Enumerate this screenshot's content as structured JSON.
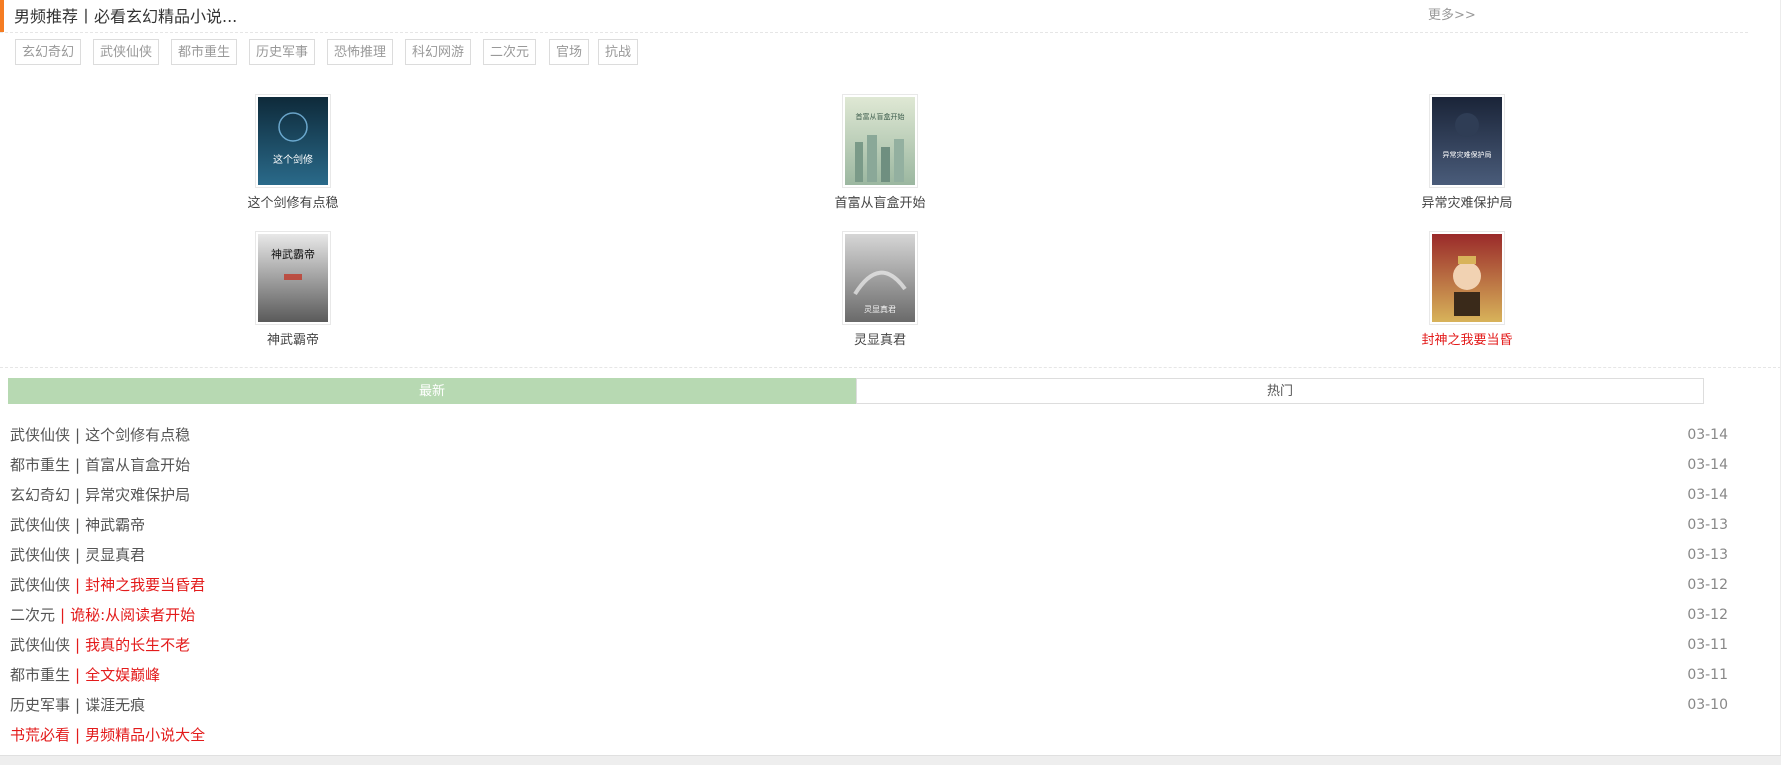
{
  "header": {
    "title": "男频推荐丨必看玄幻精品小说...",
    "more_label": "更多>>",
    "accent_color": "#f57c22"
  },
  "tags": [
    "玄幻奇幻",
    "武侠仙侠",
    "都市重生",
    "历史军事",
    "恐怖推理",
    "科幻网游",
    "二次元",
    "官场",
    "抗战"
  ],
  "books": [
    {
      "title": "这个剑修有点稳",
      "highlight": false,
      "cover_colors": [
        "#0e2a3a",
        "#2a6a8a"
      ],
      "cover_text": "这个剑修"
    },
    {
      "title": "首富从盲盒开始",
      "highlight": false,
      "cover_colors": [
        "#dfe8d4",
        "#9bb7a0"
      ],
      "cover_text": "首富从盲盒开始"
    },
    {
      "title": "异常灾难保护局",
      "highlight": false,
      "cover_colors": [
        "#1a2438",
        "#4a5c7a"
      ],
      "cover_text": "异常灾难保护局"
    },
    {
      "title": "神武霸帝",
      "highlight": false,
      "cover_colors": [
        "#e8e8e8",
        "#5a5a5a"
      ],
      "cover_text": "神武霸帝"
    },
    {
      "title": "灵显真君",
      "highlight": false,
      "cover_colors": [
        "#d6d6d6",
        "#6a6a6a"
      ],
      "cover_text": "灵显真君"
    },
    {
      "title": "封神之我要当昏",
      "highlight": true,
      "cover_colors": [
        "#9a2a2a",
        "#d8b35a"
      ],
      "cover_text": ""
    }
  ],
  "tabs": {
    "latest": "最新",
    "hot": "热门"
  },
  "list": [
    {
      "category": "武侠仙侠",
      "name": "这个剑修有点稳",
      "date": "03-14",
      "highlight": false
    },
    {
      "category": "都市重生",
      "name": "首富从盲盒开始",
      "date": "03-14",
      "highlight": false
    },
    {
      "category": "玄幻奇幻",
      "name": "异常灾难保护局",
      "date": "03-14",
      "highlight": false
    },
    {
      "category": "武侠仙侠",
      "name": "神武霸帝",
      "date": "03-13",
      "highlight": false
    },
    {
      "category": "武侠仙侠",
      "name": "灵显真君",
      "date": "03-13",
      "highlight": false
    },
    {
      "category": "武侠仙侠",
      "name": "封神之我要当昏君",
      "date": "03-12",
      "highlight": true
    },
    {
      "category": "二次元",
      "name": "诡秘:从阅读者开始",
      "date": "03-12",
      "highlight": true
    },
    {
      "category": "武侠仙侠",
      "name": "我真的长生不老",
      "date": "03-11",
      "highlight": true
    },
    {
      "category": "都市重生",
      "name": "全文娱巅峰",
      "date": "03-11",
      "highlight": true
    },
    {
      "category": "历史军事",
      "name": "谍涯无痕",
      "date": "03-10",
      "highlight": false
    },
    {
      "category": "书荒必看",
      "name": "男频精品小说大全",
      "date": "",
      "highlight": true,
      "all_red": true
    }
  ],
  "colors": {
    "red": "#e31b1b",
    "tab_active_bg": "#b7d9b2"
  }
}
